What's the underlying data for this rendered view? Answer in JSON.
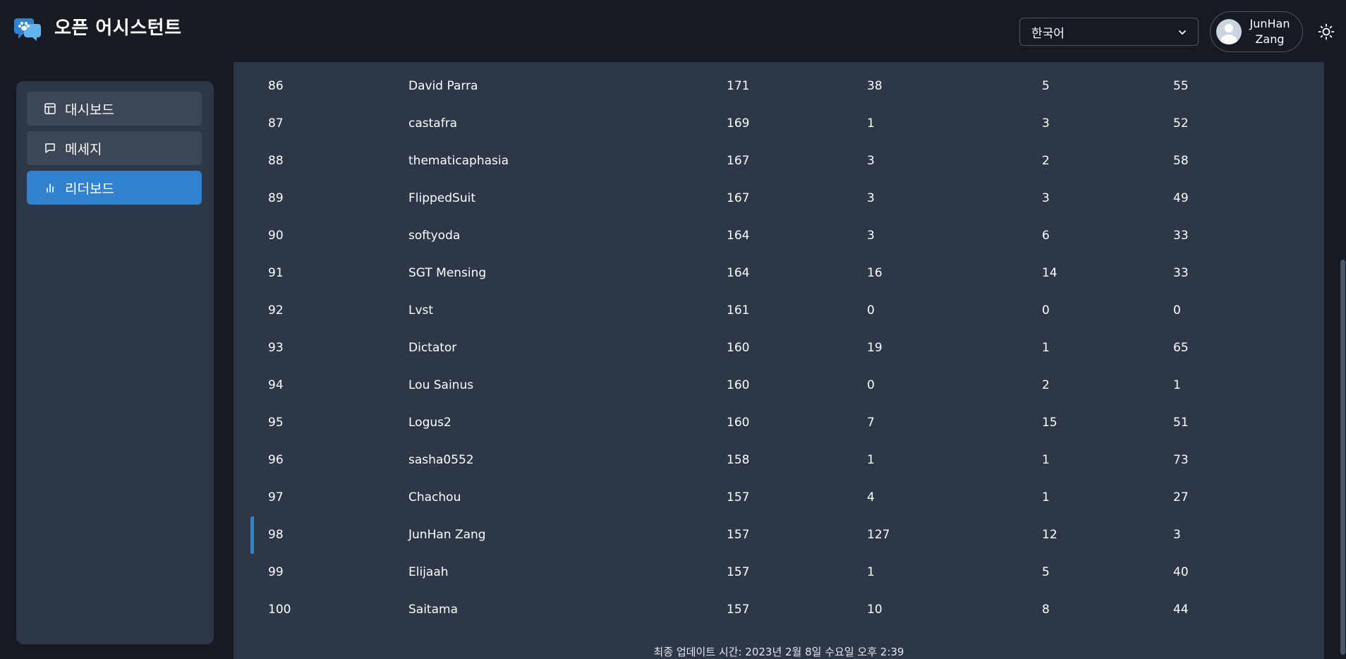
{
  "header": {
    "app_title": "오픈 어시스턴트",
    "language": "한국어",
    "user_name_line1": "JunHan",
    "user_name_line2": "Zang"
  },
  "sidebar": {
    "items": [
      {
        "label": "대시보드",
        "icon": "layout-icon",
        "active": false
      },
      {
        "label": "메세지",
        "icon": "message-icon",
        "active": false
      },
      {
        "label": "리더보드",
        "icon": "bar-chart-icon",
        "active": true
      }
    ]
  },
  "leaderboard": {
    "rows": [
      {
        "rank": "86",
        "name": "David Parra",
        "score": "171",
        "a": "38",
        "b": "5",
        "c": "55",
        "current_user": false
      },
      {
        "rank": "87",
        "name": "castafra",
        "score": "169",
        "a": "1",
        "b": "3",
        "c": "52",
        "current_user": false
      },
      {
        "rank": "88",
        "name": "thematicaphasia",
        "score": "167",
        "a": "3",
        "b": "2",
        "c": "58",
        "current_user": false
      },
      {
        "rank": "89",
        "name": "FlippedSuit",
        "score": "167",
        "a": "3",
        "b": "3",
        "c": "49",
        "current_user": false
      },
      {
        "rank": "90",
        "name": "softyoda",
        "score": "164",
        "a": "3",
        "b": "6",
        "c": "33",
        "current_user": false
      },
      {
        "rank": "91",
        "name": "SGT Mensing",
        "score": "164",
        "a": "16",
        "b": "14",
        "c": "33",
        "current_user": false
      },
      {
        "rank": "92",
        "name": "Lvst",
        "score": "161",
        "a": "0",
        "b": "0",
        "c": "0",
        "current_user": false
      },
      {
        "rank": "93",
        "name": "Dictator",
        "score": "160",
        "a": "19",
        "b": "1",
        "c": "65",
        "current_user": false
      },
      {
        "rank": "94",
        "name": "Lou Sainus",
        "score": "160",
        "a": "0",
        "b": "2",
        "c": "1",
        "current_user": false
      },
      {
        "rank": "95",
        "name": "Logus2",
        "score": "160",
        "a": "7",
        "b": "15",
        "c": "51",
        "current_user": false
      },
      {
        "rank": "96",
        "name": "sasha0552",
        "score": "158",
        "a": "1",
        "b": "1",
        "c": "73",
        "current_user": false
      },
      {
        "rank": "97",
        "name": "Chachou",
        "score": "157",
        "a": "4",
        "b": "1",
        "c": "27",
        "current_user": false
      },
      {
        "rank": "98",
        "name": "JunHan Zang",
        "score": "157",
        "a": "127",
        "b": "12",
        "c": "3",
        "current_user": true
      },
      {
        "rank": "99",
        "name": "Elijaah",
        "score": "157",
        "a": "1",
        "b": "5",
        "c": "40",
        "current_user": false
      },
      {
        "rank": "100",
        "name": "Saitama",
        "score": "157",
        "a": "10",
        "b": "8",
        "c": "44",
        "current_user": false
      }
    ],
    "last_updated": "최종 업데이트 시간: 2023년 2월 8일 수요일 오후 2:39"
  },
  "colors": {
    "background": "#171923",
    "panel": "#2d3748",
    "accent": "#3182ce",
    "nav_item": "#3c4656"
  }
}
